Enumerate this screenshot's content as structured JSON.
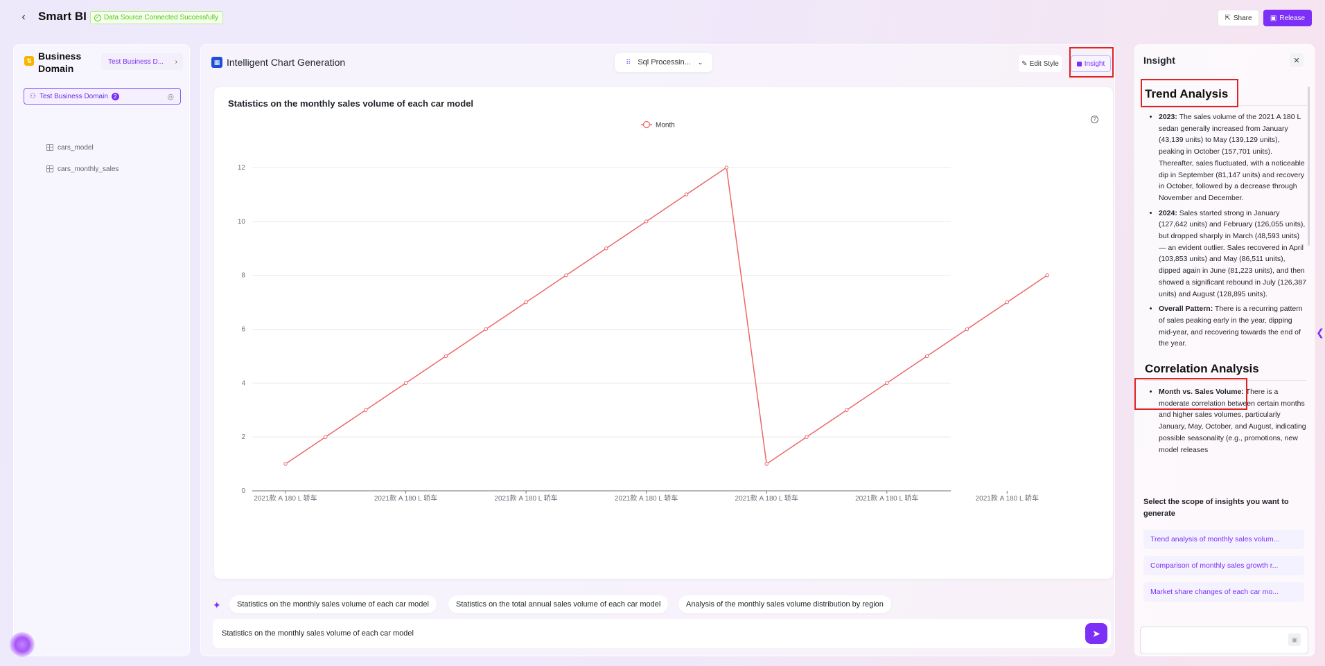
{
  "topbar": {
    "title": "Smart BI",
    "connection_status": "Data Source Connected Successfully",
    "share_label": "Share",
    "release_label": "Release"
  },
  "sidebar": {
    "title": "Business Domain",
    "domain_select": "Test Business D...",
    "root": {
      "label": "Test Business Domain",
      "count": "2"
    },
    "tables": [
      "cars_model",
      "cars_monthly_sales"
    ]
  },
  "main": {
    "title": "Intelligent Chart Generation",
    "sql_select": "Sql Processin...",
    "edit_style_label": "Edit Style",
    "insight_label": "Insight"
  },
  "chart_data": {
    "type": "line",
    "title": "Statistics on the monthly sales volume of each car model",
    "xlabel": "",
    "ylabel": "",
    "ylim": [
      0,
      12
    ],
    "yticks": [
      0,
      2,
      4,
      6,
      8,
      10,
      12
    ],
    "grid": true,
    "legend_position": "top-center",
    "x": [
      "2021款 A 180 L 轿车",
      "2021款 A 180 L 轿车",
      "2021款 A 180 L 轿车",
      "2021款 A 180 L 轿车",
      "2021款 A 180 L 轿车",
      "2021款 A 180 L 轿车",
      "2021款 A 180 L 轿车",
      "2021款 A 180 L 轿车",
      "2021款 A 180 L 轿车",
      "2021款 A 180 L 轿车",
      "2021款 A 180 L 轿车",
      "2021款 A 180 L 轿车",
      "2021款 A 180 L 轿车",
      "2021款 A 180 L 轿车",
      "2021款 A 180 L 轿车",
      "2021款 A 180 L 轿车",
      "2021款 A 180 L 轿车",
      "2021款 A 180 L 轿车",
      "2021款 A 180 L 轿车",
      "2021款 A 180 L 轿车"
    ],
    "tick_labels": [
      "2021款 A 180 L 轿车",
      "2021款 A 180 L 轿车",
      "2021款 A 180 L 轿车",
      "2021款 A 180 L 轿车",
      "2021款 A 180 L 轿车",
      "2021款 A 180 L 轿车",
      "2021款 A 180 L 轿车"
    ],
    "series": [
      {
        "name": "Month",
        "color": "#ee6666",
        "values": [
          1,
          2,
          3,
          4,
          5,
          6,
          7,
          8,
          9,
          10,
          11,
          12,
          1,
          2,
          3,
          4,
          5,
          6,
          7,
          8
        ]
      }
    ]
  },
  "suggestions": [
    "Statistics on the monthly sales volume of each car model",
    "Statistics on the total annual sales volume of each car model",
    "Analysis of the monthly sales volume distribution by region"
  ],
  "query": {
    "value": "Statistics on the monthly sales volume of each car model"
  },
  "insight": {
    "title": "Insight",
    "trend": {
      "heading": "Trend Analysis",
      "items": [
        {
          "label": "2023:",
          "text": " The sales volume of the 2021 A 180 L sedan generally increased from January (43,139 units) to May (139,129 units), peaking in October (157,701 units). Thereafter, sales fluctuated, with a noticeable dip in September (81,147 units) and recovery in October, followed by a decrease through November and December."
        },
        {
          "label": "2024:",
          "text": " Sales started strong in January (127,642 units) and February (126,055 units), but dropped sharply in March (48,593 units) — an evident outlier. Sales recovered in April (103,853 units) and May (86,511 units), dipped again in June (81,223 units), and then showed a significant rebound in July (126,387 units) and August (128,895 units)."
        },
        {
          "label": "Overall Pattern:",
          "text": " There is a recurring pattern of sales peaking early in the year, dipping mid-year, and recovering towards the end of the year."
        }
      ]
    },
    "correlation": {
      "heading": "Correlation Analysis",
      "items": [
        {
          "label": "Month vs. Sales Volume:",
          "text": " There is a moderate correlation between certain months and higher sales volumes, particularly January, May, October, and August, indicating possible seasonality (e.g., promotions, new model releases"
        }
      ]
    },
    "scope_title": "Select the scope of insights you want to generate",
    "scope_items": [
      "Trend analysis of monthly sales volum...",
      "Comparison of monthly sales growth r...",
      "Market share changes of each car mo..."
    ]
  }
}
